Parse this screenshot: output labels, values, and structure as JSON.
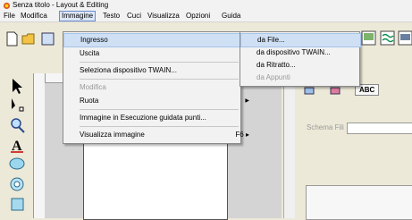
{
  "window": {
    "title": "Senza titolo - Layout & Editing"
  },
  "menubar": {
    "items": [
      {
        "label": "File"
      },
      {
        "label": "Modifica"
      },
      {
        "label": "Immagine"
      },
      {
        "label": "Testo"
      },
      {
        "label": "Cuci"
      },
      {
        "label": "Visualizza"
      },
      {
        "label": "Opzioni"
      },
      {
        "label": "Guida"
      }
    ],
    "active": "Immagine"
  },
  "image_menu": {
    "items": [
      {
        "label": "Ingresso",
        "submenu": true,
        "highlighted": true
      },
      {
        "label": "Uscita",
        "submenu": true
      },
      {
        "label": "Seleziona dispositivo TWAIN..."
      },
      {
        "label": "Modifica",
        "disabled": true
      },
      {
        "label": "Ruota",
        "submenu": true
      },
      {
        "label": "Immagine in Esecuzione guidata punti..."
      },
      {
        "label": "Visualizza immagine",
        "shortcut": "F6",
        "submenu": true
      }
    ]
  },
  "submenu_ingresso": {
    "items": [
      {
        "label": "da File...",
        "highlighted": true
      },
      {
        "label": "da dispositivo TWAIN..."
      },
      {
        "label": "da Ritratto..."
      },
      {
        "label": "da Appunti",
        "disabled": true
      }
    ]
  },
  "right_panel": {
    "tab_text": "ABC",
    "field_label": "Schema Fili"
  },
  "colors": {
    "menu_highlight": "#cfe0f5",
    "menu_bg": "#f2f2f2",
    "window_bg": "#ece9d8"
  }
}
